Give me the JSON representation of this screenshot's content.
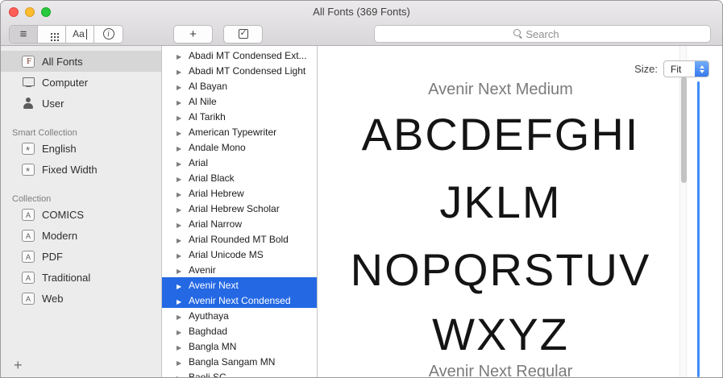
{
  "window": {
    "title": "All Fonts (369 Fonts)"
  },
  "toolbar": {
    "sample_label": "Aa",
    "add_label": "+",
    "search_placeholder": "Search"
  },
  "sidebar": {
    "add_label": "+",
    "sections": [
      {
        "header": "",
        "items": [
          {
            "label": "All Fonts",
            "icon": "fonts",
            "selected": true
          },
          {
            "label": "Computer",
            "icon": "computer",
            "selected": false
          },
          {
            "label": "User",
            "icon": "user",
            "selected": false
          }
        ]
      },
      {
        "header": "Smart Collection",
        "items": [
          {
            "label": "English",
            "icon": "smart",
            "selected": false
          },
          {
            "label": "Fixed Width",
            "icon": "smart",
            "selected": false
          }
        ]
      },
      {
        "header": "Collection",
        "items": [
          {
            "label": "COMICS",
            "icon": "collection",
            "selected": false
          },
          {
            "label": "Modern",
            "icon": "collection",
            "selected": false
          },
          {
            "label": "PDF",
            "icon": "collection",
            "selected": false
          },
          {
            "label": "Traditional",
            "icon": "collection",
            "selected": false
          },
          {
            "label": "Web",
            "icon": "collection",
            "selected": false
          }
        ]
      }
    ]
  },
  "fonts": [
    {
      "name": "Abadi MT Condensed Ext...",
      "selected": false
    },
    {
      "name": "Abadi MT Condensed Light",
      "selected": false
    },
    {
      "name": "Al Bayan",
      "selected": false
    },
    {
      "name": "Al Nile",
      "selected": false
    },
    {
      "name": "Al Tarikh",
      "selected": false
    },
    {
      "name": "American Typewriter",
      "selected": false
    },
    {
      "name": "Andale Mono",
      "selected": false
    },
    {
      "name": "Arial",
      "selected": false
    },
    {
      "name": "Arial Black",
      "selected": false
    },
    {
      "name": "Arial Hebrew",
      "selected": false
    },
    {
      "name": "Arial Hebrew Scholar",
      "selected": false
    },
    {
      "name": "Arial Narrow",
      "selected": false
    },
    {
      "name": "Arial Rounded MT Bold",
      "selected": false
    },
    {
      "name": "Arial Unicode MS",
      "selected": false
    },
    {
      "name": "Avenir",
      "selected": false
    },
    {
      "name": "Avenir Next",
      "selected": true
    },
    {
      "name": "Avenir Next Condensed",
      "selected": true
    },
    {
      "name": "Ayuthaya",
      "selected": false
    },
    {
      "name": "Baghdad",
      "selected": false
    },
    {
      "name": "Bangla MN",
      "selected": false
    },
    {
      "name": "Bangla Sangam MN",
      "selected": false
    },
    {
      "name": "Baoli SC",
      "selected": false
    }
  ],
  "preview": {
    "size_label": "Size:",
    "size_value": "Fit",
    "font_name": "Avenir Next Medium",
    "lines": [
      "ABCDEFGHI",
      "JKLM",
      "NOPQRSTUV",
      "WXYZ"
    ],
    "next_font_name": "Avenir Next Regular"
  },
  "colors": {
    "selection_blue": "#2468e4",
    "slider_blue": "#3f8ef7",
    "traffic_red": "#ff5f57",
    "traffic_yellow": "#febc2e",
    "traffic_green": "#28c840"
  }
}
